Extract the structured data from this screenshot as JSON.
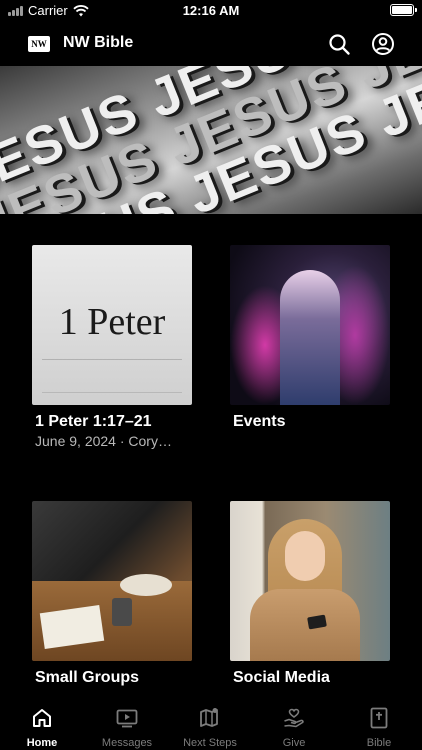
{
  "status_bar": {
    "carrier": "Carrier",
    "time": "12:16 AM"
  },
  "header": {
    "logo_text": "NW",
    "title": "NW Bible",
    "search_icon": "search-icon",
    "profile_icon": "profile-icon"
  },
  "hero": {
    "lines": [
      "JESUS JESUS JESUS",
      "JESUS JESUS JESUS",
      "JESUS JESUS JESUS"
    ]
  },
  "cards": [
    {
      "title": "1 Peter 1:17–21",
      "subtitle": "June 9, 2024 · Cory…",
      "image_text": "1 Peter"
    },
    {
      "title": "Events",
      "subtitle": ""
    },
    {
      "title": "Small Groups",
      "subtitle": ""
    },
    {
      "title": "Social Media",
      "subtitle": ""
    }
  ],
  "tab_bar": {
    "active": "Home",
    "tabs": [
      {
        "label": "Home",
        "icon": "home-icon"
      },
      {
        "label": "Messages",
        "icon": "play-icon"
      },
      {
        "label": "Next Steps",
        "icon": "map-icon"
      },
      {
        "label": "Give",
        "icon": "give-icon"
      },
      {
        "label": "Bible",
        "icon": "bible-icon"
      }
    ]
  }
}
